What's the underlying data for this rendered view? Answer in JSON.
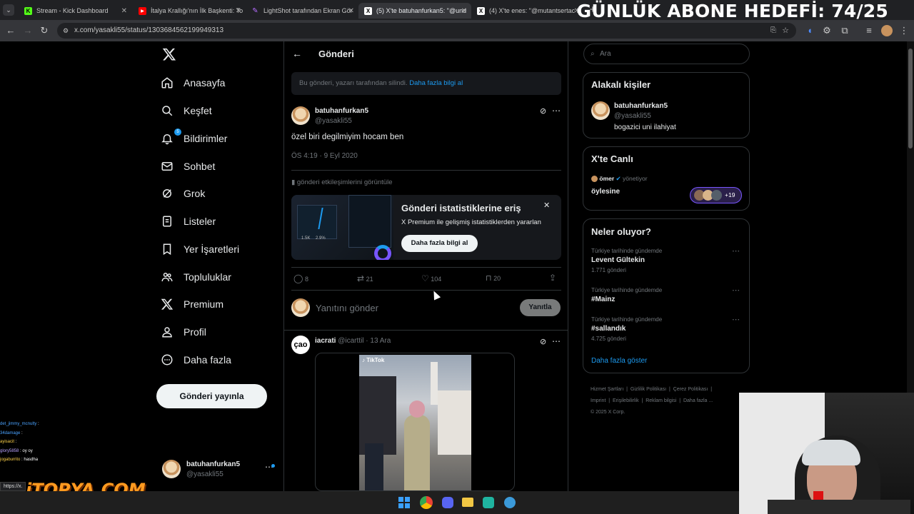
{
  "browser": {
    "tabs": [
      {
        "title": "Stream - Kick Dashboard",
        "icon": "kick-icon",
        "color": "#53fc18"
      },
      {
        "title": "İtalya Krallığı'nın İlk Başkenti: To",
        "icon": "youtube-icon",
        "color": "#ff0000"
      },
      {
        "title": "LightShot tarafından Ekran Gör",
        "icon": "lightshot-icon",
        "color": "#b56cff"
      },
      {
        "title": "(5) X'te batuhanfurkan5: \"@und",
        "icon": "x-icon",
        "color": "#ffffff"
      },
      {
        "title": "(4) X'te enes: \"@mutantsertac h",
        "icon": "x-icon",
        "color": "#ffffff"
      }
    ],
    "url": "x.com/yasakli55/status/1303684562199949313",
    "status_url": "https://x."
  },
  "overlay": {
    "goal": "GÜNLÜK ABONE HEDEFİ: 74/25",
    "logo": "iTOPYA.COM"
  },
  "nav": {
    "items": [
      {
        "label": "Anasayfa",
        "icon": "home-icon"
      },
      {
        "label": "Keşfet",
        "icon": "search-icon"
      },
      {
        "label": "Bildirimler",
        "icon": "bell-icon",
        "badge": "5"
      },
      {
        "label": "Sohbet",
        "icon": "mail-icon"
      },
      {
        "label": "Grok",
        "icon": "grok-icon"
      },
      {
        "label": "Listeler",
        "icon": "list-icon"
      },
      {
        "label": "Yer İşaretleri",
        "icon": "bookmark-icon"
      },
      {
        "label": "Topluluklar",
        "icon": "people-icon"
      },
      {
        "label": "Premium",
        "icon": "x-icon"
      },
      {
        "label": "Profil",
        "icon": "person-icon"
      },
      {
        "label": "Daha fazla",
        "icon": "more-circle-icon"
      }
    ],
    "post_button": "Gönderi yayınla",
    "account": {
      "name": "batuhanfurkan5",
      "handle": "@yasakli55"
    }
  },
  "main": {
    "header": "Gönderi",
    "deleted_notice": "Bu gönderi, yazarı tarafından silindi.",
    "deleted_link": "Daha fazla bilgi al",
    "post": {
      "name": "batuhanfurkan5",
      "handle": "@yasakli55",
      "text": "özel biri degilmiyim hocam ben",
      "time": "ÖS 4:19 · 9 Eyl 2020",
      "engagements_link": "gönderi etkileşimlerini görüntüle",
      "promo_title": "Gönderi istatistiklerine eriş",
      "promo_sub": "X Premium ile gelişmiş istatistiklerden yararlan",
      "promo_button": "Daha fazla bilgi al",
      "replies": "8",
      "reposts": "21",
      "likes": "104",
      "bookmarks": "20"
    },
    "reply_placeholder": "Yanıtını gönder",
    "reply_button": "Yanıtla",
    "reply_post": {
      "avatar_text": "çao",
      "name": "iacrati",
      "handle": "@icarttil",
      "date": "· 13 Ara",
      "video_label": "TikTok"
    }
  },
  "right": {
    "search_placeholder": "Ara",
    "related_title": "Alakalı kişiler",
    "related": {
      "name": "batuhanfurkan5",
      "handle": "@yasakli55",
      "bio": "bogazici uni ilahiyat"
    },
    "live_title": "X'te Canlı",
    "live": {
      "host": "ömer",
      "status": "yönetiyor",
      "title": "öylesine",
      "count": "+19"
    },
    "trends_title": "Neler oluyor?",
    "trends": [
      {
        "context": "Türkiye tarihinde gündemde",
        "name": "Levent Gültekin",
        "posts": "1.771 gönderi"
      },
      {
        "context": "Türkiye tarihinde gündemde",
        "name": "#Mainz",
        "posts": ""
      },
      {
        "context": "Türkiye tarihinde gündemde",
        "name": "#sallandık",
        "posts": "4.725 gönderi"
      }
    ],
    "show_more": "Daha fazla göster",
    "footer": [
      "Hizmet Şartları",
      "Gizlilik Politikası",
      "Çerez Politikası",
      "Imprint",
      "Erişilebilirlik",
      "Reklam bilgisi",
      "Daha fazla ...",
      "© 2025 X Corp."
    ]
  },
  "chat": [
    {
      "user": "det_jimmy_mcnulty",
      "msg": "",
      "color": "#4aa3ff"
    },
    {
      "user": "34damage",
      "msg": "",
      "color": "#4aa3ff"
    },
    {
      "user": "ayisacit",
      "msg": "",
      "color": "#ffd24a"
    },
    {
      "user": "glory5858",
      "msg": "oy oy",
      "color": "#b9a3ff"
    },
    {
      "user": "jogaburrito",
      "msg": "hasdha",
      "color": "#ffd24a"
    }
  ]
}
